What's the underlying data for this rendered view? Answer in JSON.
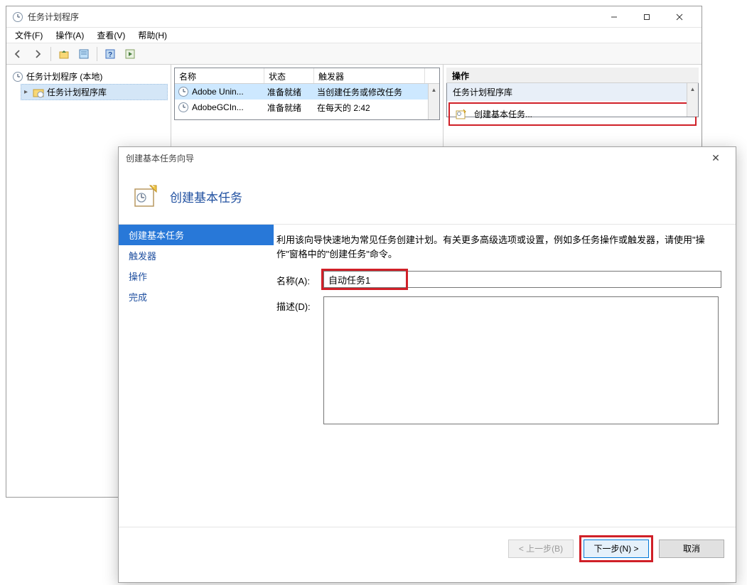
{
  "main_window": {
    "title": "任务计划程序",
    "menus": {
      "file": "文件(F)",
      "action": "操作(A)",
      "view": "查看(V)",
      "help": "帮助(H)"
    },
    "tree": {
      "root": "任务计划程序 (本地)",
      "library": "任务计划程序库"
    },
    "table": {
      "headers": {
        "name": "名称",
        "status": "状态",
        "trigger": "触发器"
      },
      "rows": [
        {
          "name": "Adobe Unin...",
          "status": "准备就绪",
          "trigger": "当创建任务或修改任务"
        },
        {
          "name": "AdobeGCIn...",
          "status": "准备就绪",
          "trigger": "在每天的 2:42"
        }
      ]
    },
    "actions_pane": {
      "title": "操作",
      "group": "任务计划程序库",
      "create_basic": "创建基本任务..."
    }
  },
  "wizard": {
    "title": "创建基本任务向导",
    "header": "创建基本任务",
    "steps": {
      "s1": "创建基本任务",
      "s2": "触发器",
      "s3": "操作",
      "s4": "完成"
    },
    "description": "利用该向导快速地为常见任务创建计划。有关更多高级选项或设置，例如多任务操作或触发器，请使用\"操作\"窗格中的\"创建任务\"命令。",
    "labels": {
      "name": "名称(A):",
      "description": "描述(D):"
    },
    "values": {
      "name": "自动任务1",
      "description": ""
    },
    "buttons": {
      "back": "< 上一步(B)",
      "next": "下一步(N) >",
      "cancel": "取消"
    }
  }
}
